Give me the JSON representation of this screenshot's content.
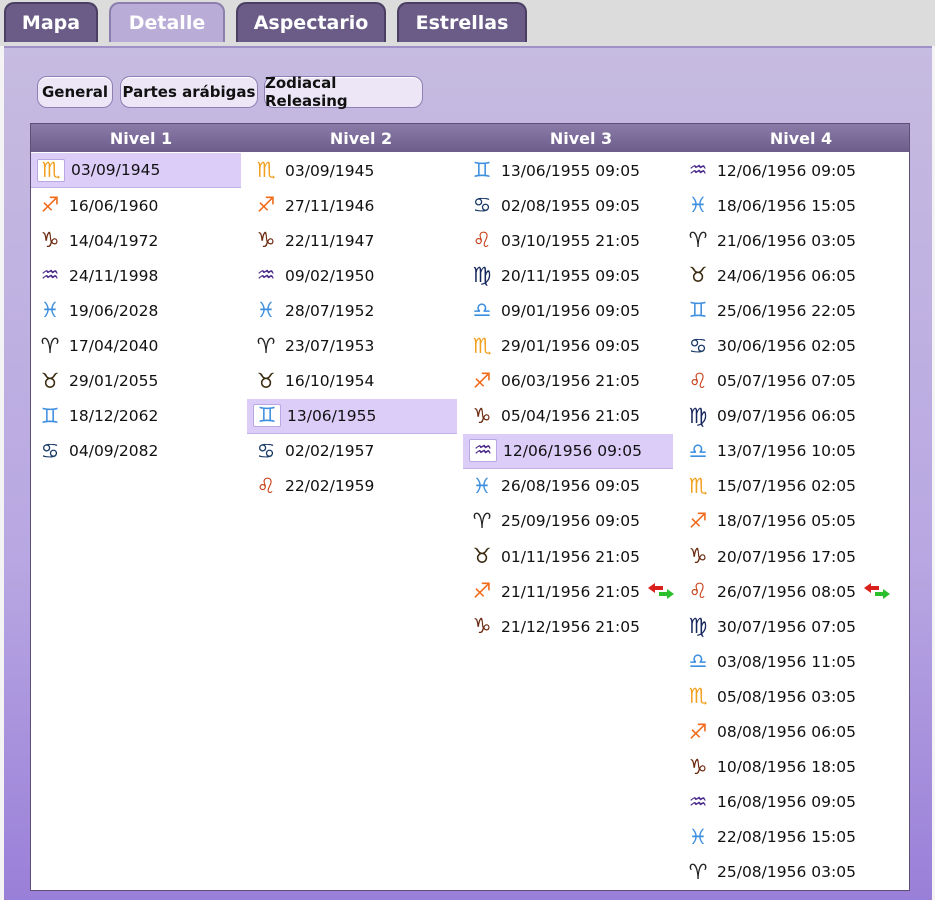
{
  "tabs": [
    {
      "label": "Mapa",
      "active": false
    },
    {
      "label": "Detalle",
      "active": true
    },
    {
      "label": "Aspectario",
      "active": false
    },
    {
      "label": "Estrellas",
      "active": false
    }
  ],
  "subtabs": [
    {
      "label": "General"
    },
    {
      "label": "Partes arábigas"
    },
    {
      "label": "Zodiacal Releasing"
    }
  ],
  "headers": [
    "Nivel 1",
    "Nivel 2",
    "Nivel 3",
    "Nivel 4"
  ],
  "signs": {
    "aries": {
      "glyph": "♈",
      "color": "#222222"
    },
    "taurus": {
      "glyph": "♉",
      "color": "#3a2a10"
    },
    "gemini": {
      "glyph": "♊",
      "color": "#3f8fe0"
    },
    "cancer": {
      "glyph": "♋",
      "color": "#1a3a66"
    },
    "leo": {
      "glyph": "♌",
      "color": "#c8401a"
    },
    "virgo": {
      "glyph": "♍",
      "color": "#16265e"
    },
    "libra": {
      "glyph": "♎",
      "color": "#3f8fe0"
    },
    "scorpio": {
      "glyph": "♏",
      "color": "#f2a020"
    },
    "sagittarius": {
      "glyph": "♐",
      "color": "#f26a1a"
    },
    "capricorn": {
      "glyph": "♑",
      "color": "#6a2a10"
    },
    "aquarius": {
      "glyph": "♒",
      "color": "#4a2a8a"
    },
    "pisces": {
      "glyph": "♓",
      "color": "#3f8fe0"
    }
  },
  "columns": [
    [
      {
        "sign": "scorpio",
        "date": "03/09/1945",
        "highlight": true
      },
      {
        "sign": "sagittarius",
        "date": "16/06/1960"
      },
      {
        "sign": "capricorn",
        "date": "14/04/1972"
      },
      {
        "sign": "aquarius",
        "date": "24/11/1998"
      },
      {
        "sign": "pisces",
        "date": "19/06/2028"
      },
      {
        "sign": "aries",
        "date": "17/04/2040"
      },
      {
        "sign": "taurus",
        "date": "29/01/2055"
      },
      {
        "sign": "gemini",
        "date": "18/12/2062"
      },
      {
        "sign": "cancer",
        "date": "04/09/2082"
      }
    ],
    [
      {
        "sign": "scorpio",
        "date": "03/09/1945"
      },
      {
        "sign": "sagittarius",
        "date": "27/11/1946"
      },
      {
        "sign": "capricorn",
        "date": "22/11/1947"
      },
      {
        "sign": "aquarius",
        "date": "09/02/1950"
      },
      {
        "sign": "pisces",
        "date": "28/07/1952"
      },
      {
        "sign": "aries",
        "date": "23/07/1953"
      },
      {
        "sign": "taurus",
        "date": "16/10/1954"
      },
      {
        "sign": "gemini",
        "date": "13/06/1955",
        "highlight": true
      },
      {
        "sign": "cancer",
        "date": "02/02/1957"
      },
      {
        "sign": "leo",
        "date": "22/02/1959"
      }
    ],
    [
      {
        "sign": "gemini",
        "date": "13/06/1955 09:05"
      },
      {
        "sign": "cancer",
        "date": "02/08/1955 09:05"
      },
      {
        "sign": "leo",
        "date": "03/10/1955 21:05"
      },
      {
        "sign": "virgo",
        "date": "20/11/1955 09:05"
      },
      {
        "sign": "libra",
        "date": "09/01/1956 09:05"
      },
      {
        "sign": "scorpio",
        "date": "29/01/1956 09:05"
      },
      {
        "sign": "sagittarius",
        "date": "06/03/1956 21:05"
      },
      {
        "sign": "capricorn",
        "date": "05/04/1956 21:05"
      },
      {
        "sign": "aquarius",
        "date": "12/06/1956 09:05",
        "highlight": true
      },
      {
        "sign": "pisces",
        "date": "26/08/1956 09:05"
      },
      {
        "sign": "aries",
        "date": "25/09/1956 09:05"
      },
      {
        "sign": "taurus",
        "date": "01/11/1956 21:05"
      },
      {
        "sign": "sagittarius",
        "date": "21/11/1956 21:05",
        "swap": true
      },
      {
        "sign": "capricorn",
        "date": "21/12/1956 21:05"
      }
    ],
    [
      {
        "sign": "aquarius",
        "date": "12/06/1956 09:05"
      },
      {
        "sign": "pisces",
        "date": "18/06/1956 15:05"
      },
      {
        "sign": "aries",
        "date": "21/06/1956 03:05"
      },
      {
        "sign": "taurus",
        "date": "24/06/1956 06:05"
      },
      {
        "sign": "gemini",
        "date": "25/06/1956 22:05"
      },
      {
        "sign": "cancer",
        "date": "30/06/1956 02:05"
      },
      {
        "sign": "leo",
        "date": "05/07/1956 07:05"
      },
      {
        "sign": "virgo",
        "date": "09/07/1956 06:05"
      },
      {
        "sign": "libra",
        "date": "13/07/1956 10:05"
      },
      {
        "sign": "scorpio",
        "date": "15/07/1956 02:05"
      },
      {
        "sign": "sagittarius",
        "date": "18/07/1956 05:05"
      },
      {
        "sign": "capricorn",
        "date": "20/07/1956 17:05"
      },
      {
        "sign": "leo",
        "date": "26/07/1956 08:05",
        "swap": true
      },
      {
        "sign": "virgo",
        "date": "30/07/1956 07:05"
      },
      {
        "sign": "libra",
        "date": "03/08/1956 11:05"
      },
      {
        "sign": "scorpio",
        "date": "05/08/1956 03:05"
      },
      {
        "sign": "sagittarius",
        "date": "08/08/1956 06:05"
      },
      {
        "sign": "capricorn",
        "date": "10/08/1956 18:05"
      },
      {
        "sign": "aquarius",
        "date": "16/08/1956 09:05"
      },
      {
        "sign": "pisces",
        "date": "22/08/1956 15:05"
      },
      {
        "sign": "aries",
        "date": "25/08/1956 03:05"
      }
    ]
  ]
}
